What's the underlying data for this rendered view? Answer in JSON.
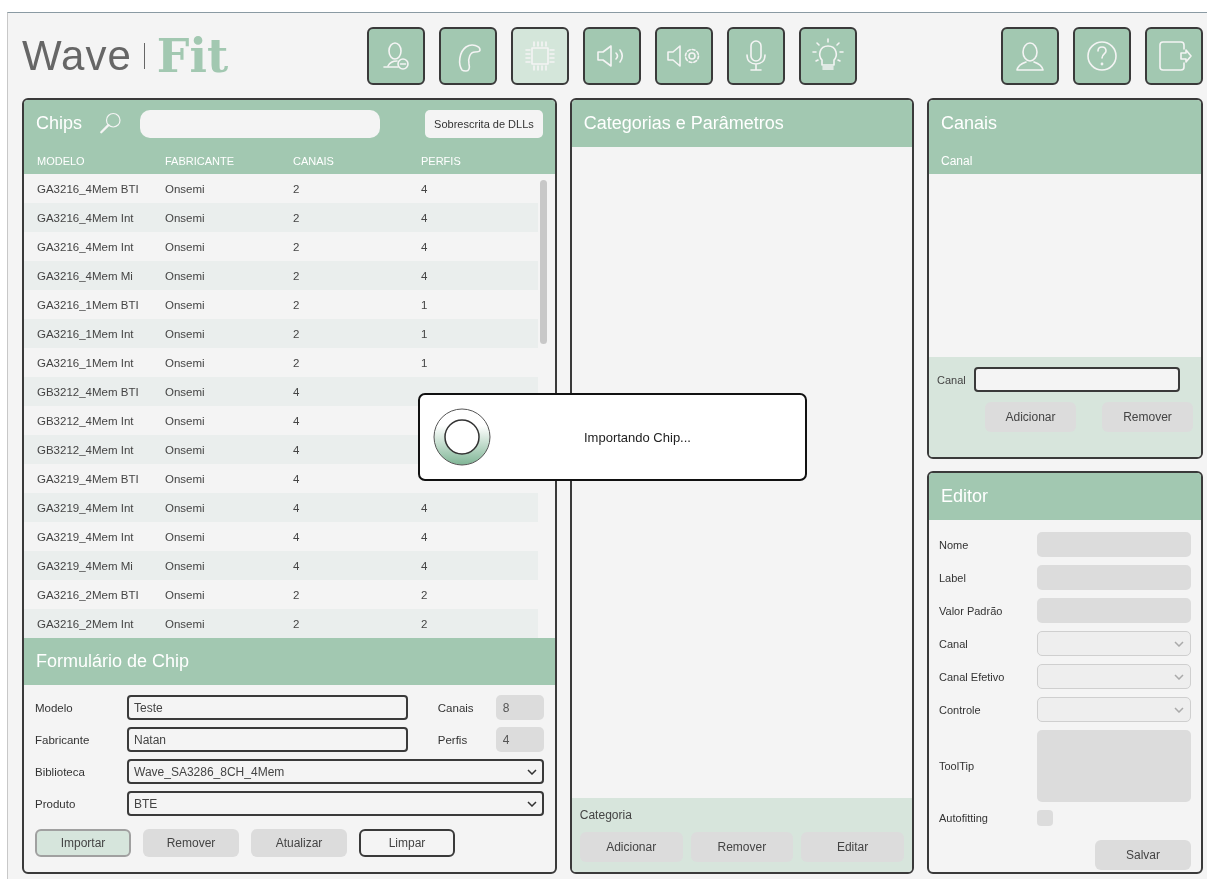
{
  "logo": {
    "word": "Wave",
    "accent": "Fit"
  },
  "toolbar": [
    {
      "selected": false
    },
    {
      "selected": false
    },
    {
      "selected": true
    },
    {
      "selected": false
    },
    {
      "selected": false
    },
    {
      "selected": false
    },
    {
      "selected": false
    }
  ],
  "chips": {
    "title": "Chips",
    "overwrite_button": "Sobrescrita de DLLs",
    "columns": [
      "MODELO",
      "FABRICANTE",
      "CANAIS",
      "PERFIS"
    ],
    "rows": [
      {
        "modelo": "GA3216_4Mem BTI",
        "fabricante": "Onsemi",
        "canais": "2",
        "perfis": "4"
      },
      {
        "modelo": "GA3216_4Mem Int",
        "fabricante": "Onsemi",
        "canais": "2",
        "perfis": "4"
      },
      {
        "modelo": "GA3216_4Mem Int",
        "fabricante": "Onsemi",
        "canais": "2",
        "perfis": "4"
      },
      {
        "modelo": "GA3216_4Mem Mi",
        "fabricante": "Onsemi",
        "canais": "2",
        "perfis": "4"
      },
      {
        "modelo": "GA3216_1Mem BTI",
        "fabricante": "Onsemi",
        "canais": "2",
        "perfis": "1"
      },
      {
        "modelo": "GA3216_1Mem Int",
        "fabricante": "Onsemi",
        "canais": "2",
        "perfis": "1"
      },
      {
        "modelo": "GA3216_1Mem Int",
        "fabricante": "Onsemi",
        "canais": "2",
        "perfis": "1"
      },
      {
        "modelo": "GB3212_4Mem BTI",
        "fabricante": "Onsemi",
        "canais": "4"
      },
      {
        "modelo": "GB3212_4Mem Int",
        "fabricante": "Onsemi",
        "canais": "4"
      },
      {
        "modelo": "GB3212_4Mem Int",
        "fabricante": "Onsemi",
        "canais": "4"
      },
      {
        "modelo": "GA3219_4Mem BTI",
        "fabricante": "Onsemi",
        "canais": "4"
      },
      {
        "modelo": "GA3219_4Mem Int",
        "fabricante": "Onsemi",
        "canais": "4",
        "perfis": "4"
      },
      {
        "modelo": "GA3219_4Mem Int",
        "fabricante": "Onsemi",
        "canais": "4",
        "perfis": "4"
      },
      {
        "modelo": "GA3219_4Mem Mi",
        "fabricante": "Onsemi",
        "canais": "4",
        "perfis": "4"
      },
      {
        "modelo": "GA3216_2Mem BTI",
        "fabricante": "Onsemi",
        "canais": "2",
        "perfis": "2"
      },
      {
        "modelo": "GA3216_2Mem Int",
        "fabricante": "Onsemi",
        "canais": "2",
        "perfis": "2"
      }
    ]
  },
  "chip_form": {
    "title": "Formulário de Chip",
    "modelo": {
      "label": "Modelo",
      "value": "Teste"
    },
    "canais": {
      "label": "Canais",
      "value": "8"
    },
    "fabricante": {
      "label": "Fabricante",
      "value": "Natan"
    },
    "perfis": {
      "label": "Perfis",
      "value": "4"
    },
    "biblioteca": {
      "label": "Biblioteca",
      "value": "Wave_SA3286_8CH_4Mem"
    },
    "produto": {
      "label": "Produto",
      "value": "BTE"
    },
    "buttons": [
      {
        "label": "Importar",
        "kind": "primary"
      },
      {
        "label": "Remover",
        "kind": "plain"
      },
      {
        "label": "Atualizar",
        "kind": "plain"
      },
      {
        "label": "Limpar",
        "kind": "outline"
      }
    ]
  },
  "categories": {
    "title": "Categorias e Parâmetros",
    "footer_label": "Categoria",
    "buttons": [
      "Adicionar",
      "Remover",
      "Editar"
    ]
  },
  "channels": {
    "title": "Canais",
    "column": "Canal",
    "field_label": "Canal",
    "buttons": [
      "Adicionar",
      "Remover"
    ]
  },
  "editor": {
    "title": "Editor",
    "fields": [
      {
        "label": "Nome",
        "kind": "text"
      },
      {
        "label": "Label",
        "kind": "text"
      },
      {
        "label": "Valor Padrão",
        "kind": "text"
      },
      {
        "label": "Canal",
        "kind": "select"
      },
      {
        "label": "Canal Efetivo",
        "kind": "select"
      },
      {
        "label": "Controle",
        "kind": "select"
      },
      {
        "label": "ToolTip",
        "kind": "textarea"
      },
      {
        "label": "Autofitting",
        "kind": "checkbox",
        "checked": false
      }
    ],
    "save_button": "Salvar"
  },
  "modal": {
    "message": "Importando Chip..."
  }
}
